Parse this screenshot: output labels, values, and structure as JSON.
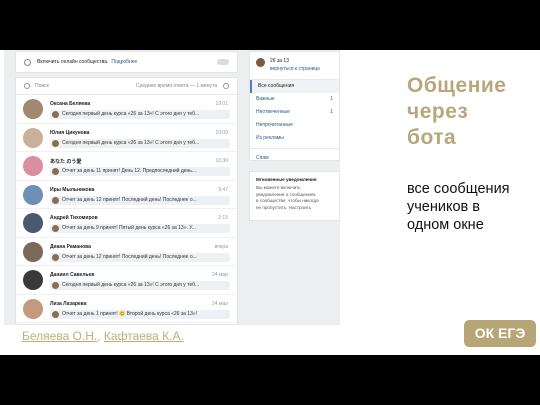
{
  "topbar": {
    "text": "Включить онлайн сообщества.",
    "more": "Подробнее"
  },
  "search": {
    "placeholder": "Поиск",
    "response": "Среднее время ответа — 1 минута"
  },
  "conversations": [
    {
      "name": "Оксана Беляева",
      "time": "19:01",
      "message": "Сегодня первый день курса «26 за 13»! С этого дня у теб...",
      "avatar_color": "#a0896e"
    },
    {
      "name": "Юлия Цикунова",
      "time": "19:00",
      "message": "Сегодня первый день курса «26 за 13»! С этого дня у теб...",
      "avatar_color": "#c8b09a"
    },
    {
      "name": "あなた のう愛",
      "time": "10:30",
      "message": "Отчет за день 11 принят! День 12. Предпоследний день...",
      "avatar_color": "#d98fa0"
    },
    {
      "name": "Иры Мыльникова",
      "time": "9:47",
      "message": "Отчет за день 12 принят! Последний день! Последнее о...",
      "avatar_color": "#6d8fb3"
    },
    {
      "name": "Андрей Тихомиров",
      "time": "2:15",
      "message": "Отчет за день 9 принят! Пятый день курса «26 за 13». У...",
      "avatar_color": "#4a5a6e"
    },
    {
      "name": "Диана Раманова",
      "time": "вчера",
      "message": "Отчет за день 12 принят! Последний день! Последнее о...",
      "avatar_color": "#7a6a5a"
    },
    {
      "name": "Даниил Савельев",
      "time": "24 мар",
      "message": "Сегодня первый день курса «26 за 13»! С этого дня у теб...",
      "avatar_color": "#3a3a3a"
    },
    {
      "name": "Лиза Лазарева",
      "time": "24 мар",
      "message": "Отчет за день 1 принят! 😊 Второй день курса «26 за 13»!",
      "avatar_color": "#c49a7e"
    }
  ],
  "side": {
    "title": "26 за 13",
    "back": "вернуться к странице",
    "items": [
      {
        "label": "Все сообщения",
        "count": "",
        "active": true
      },
      {
        "label": "Важные",
        "count": "1",
        "active": false
      },
      {
        "label": "Неотвеченные",
        "count": "1",
        "active": false
      },
      {
        "label": "Непрочитанные",
        "count": "",
        "active": false
      },
      {
        "label": "Из рекламы",
        "count": "",
        "active": false
      }
    ],
    "spam": "Спам"
  },
  "notifications": {
    "title": "Мгновенные уведомления",
    "lines": [
      "Вы можете включить",
      "уведомления о сообщениях",
      "в сообществе, чтобы никогда",
      "не пропустить. Настроить"
    ]
  },
  "slide": {
    "title_lines": [
      "Общение",
      "через",
      "бота"
    ],
    "desc_lines": [
      "все сообщения",
      "учеников в",
      "одном окне"
    ],
    "author1": "Беляева О.Н.",
    "author_sep": ", ",
    "author2": "Кафтаева К.А.",
    "badge": "ОК ЕГЭ"
  }
}
